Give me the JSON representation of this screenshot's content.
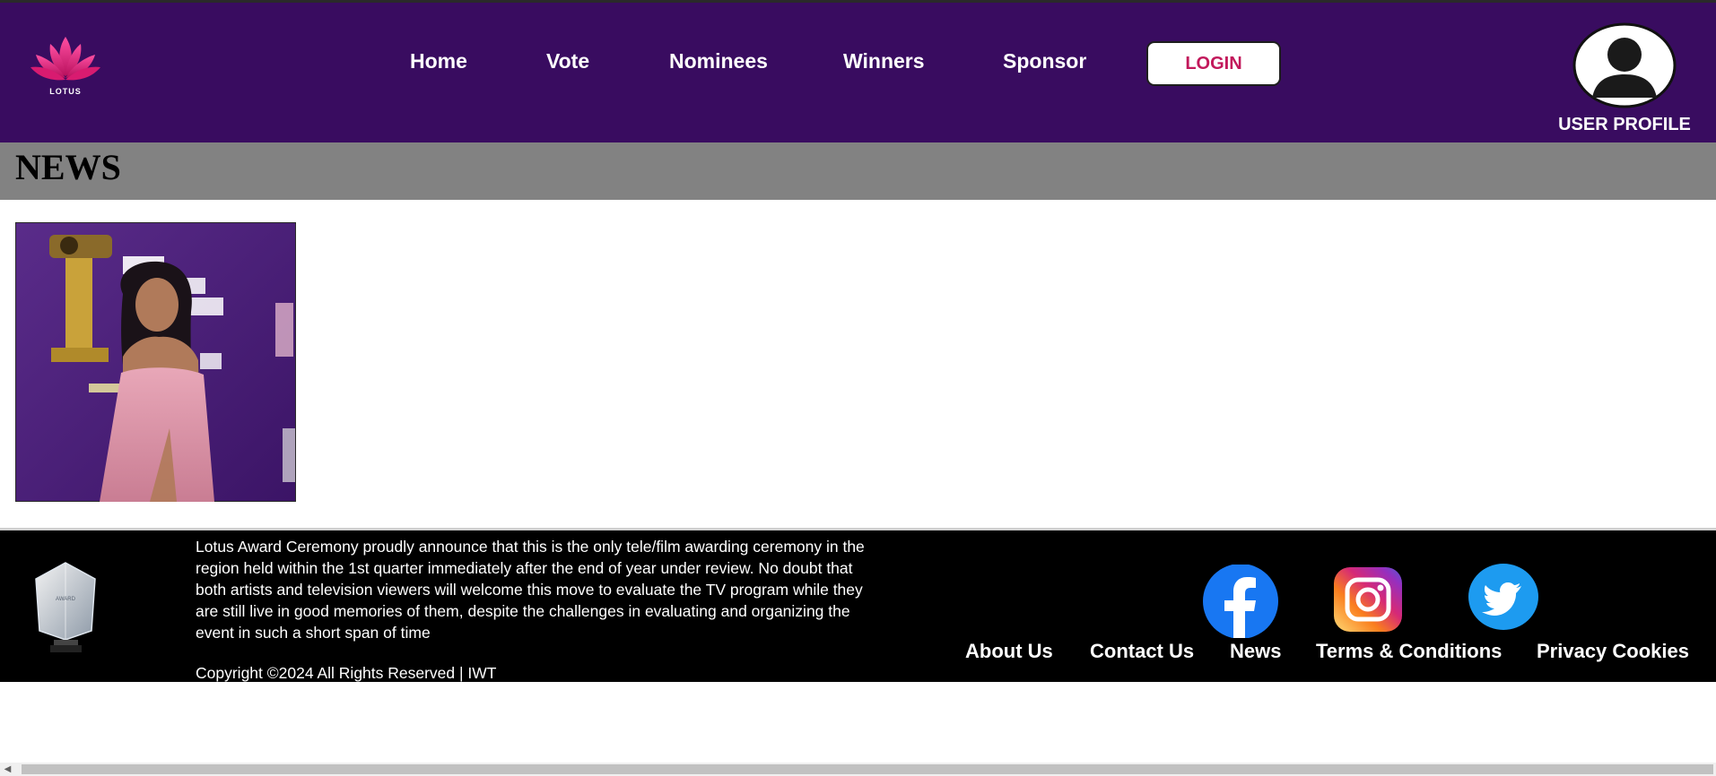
{
  "header": {
    "logo_text": "LOTUS",
    "nav": [
      {
        "label": "Home"
      },
      {
        "label": "Vote"
      },
      {
        "label": "Nominees"
      },
      {
        "label": "Winners"
      },
      {
        "label": "Sponsor"
      }
    ],
    "login_label": "LOGIN",
    "user_profile_label": "USER PROFILE",
    "background_color": "#390c60",
    "accent_color": "#c2185b"
  },
  "news": {
    "title": "NEWS",
    "image_icon": "award-winner-photo"
  },
  "footer": {
    "description": "Lotus Award Ceremony proudly announce that this is the only tele/film awarding ceremony in the region held within the 1st quarter immediately after the end of year under review. No doubt that both artists and television viewers will welcome this move to evaluate the TV program while they are still live in good memories of them, despite the challenges in evaluating and organizing the event in such a short span of time",
    "copyright": "Copyright ©2024 All Rights Reserved | IWT",
    "trophy_text": "AWARD",
    "social": [
      "facebook-icon",
      "instagram-icon",
      "twitter-icon"
    ],
    "links": [
      {
        "label": "About Us"
      },
      {
        "label": "Contact Us"
      },
      {
        "label": "News"
      },
      {
        "label": "Terms & Conditions"
      },
      {
        "label": "Privacy Cookies"
      }
    ]
  }
}
